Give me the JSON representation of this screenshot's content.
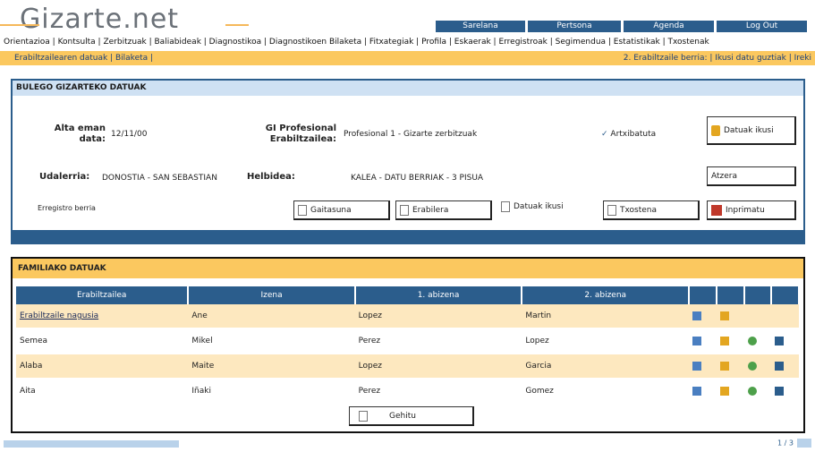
{
  "logo": "Gizarte.net",
  "topnav": [
    "Sarelana",
    "Pertsona",
    "Agenda",
    "Log Out"
  ],
  "menubar": "Orientazioa | Kontsulta | Zerbitzuak | Baliabideak | Diagnostikoa | Diagnostikoen Bilaketa | Fitxategiak | Profila | Eskaerak | Erregistroak | Segimendua | Estatistikak | Txostenak",
  "orangebar": {
    "left": "Erabiltzailearen datuak | Bilaketa |",
    "right": "2. Erabiltzaile berria: | Ikusi datu guztiak | Ireki"
  },
  "file_panel": {
    "title": "BULEGO GIZARTEKO DATUAK",
    "created_label": "Alta eman data:",
    "created_value": "12/11/00",
    "prof_label": "GI Profesional Erabiltzailea:",
    "prof_value": "Profesional 1 - Gizarte zerbitzuak",
    "archive_label": "Artxibatuta",
    "history_btn": "Datuak ikusi",
    "user_label": "Udalerria:",
    "user_value": "DONOSTIA - SAN SEBASTIAN",
    "address_label": "Helbidea:",
    "address_value": "KALEA - DATU BERRIAK - 3 PISUA",
    "back_btn": "Atzera",
    "prev_btn": "Erregistro berria",
    "b1": "Gaitasuna",
    "b2": "Erabilera",
    "b3": "Datuak ikusi",
    "b4": "Txostena",
    "b5": "Inprimatu"
  },
  "family_panel": {
    "title": "FAMILIAKO DATUAK",
    "columns": [
      "Erabiltzailea",
      "Izena",
      "1. abizena",
      "2. abizena"
    ],
    "rows": [
      {
        "c1": "Erabiltzaile nagusia",
        "c2": "Ane",
        "c3": "Lopez",
        "c4": "Martin"
      },
      {
        "c1": "Semea",
        "c2": "Mikel",
        "c3": "Perez",
        "c4": "Lopez"
      },
      {
        "c1": "Alaba",
        "c2": "Maite",
        "c3": "Lopez",
        "c4": "Garcia"
      },
      {
        "c1": "Aita",
        "c2": "Iñaki",
        "c3": "Perez",
        "c4": "Gomez"
      }
    ],
    "new_btn": "Gehitu"
  },
  "footer_right": "1 / 3"
}
